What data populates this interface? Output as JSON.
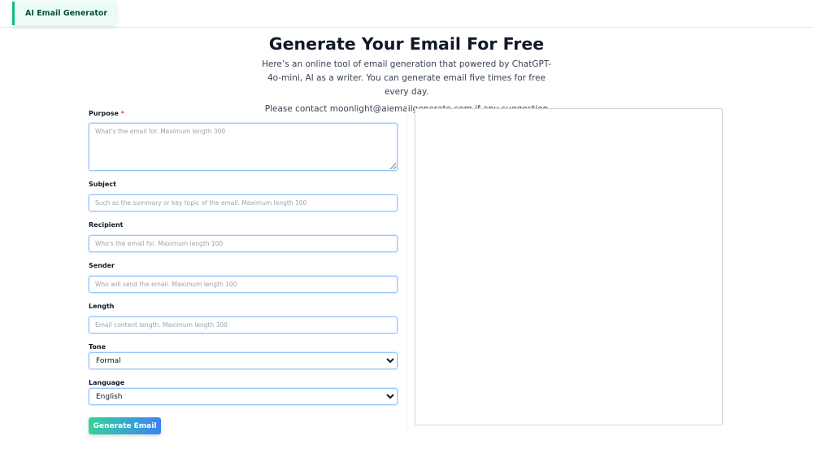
{
  "header": {
    "brand": "AI Email Generator"
  },
  "hero": {
    "title": "Generate Your Email For Free",
    "description": "Here’s an online tool of email generation that powered by ChatGPT-4o-mini, AI as a writer. You can generate email five times for free every day.",
    "contact": "Please contact moonlight@aiemailgenerate.com if any suggestion"
  },
  "form": {
    "purpose": {
      "label": "Purpose",
      "required_mark": "*",
      "placeholder": "What's the email for. Maximum length 300"
    },
    "subject": {
      "label": "Subject",
      "placeholder": "Such as the summary or key topic of the email. Maximum length 100"
    },
    "recipient": {
      "label": "Recipient",
      "placeholder": "Who's the email for. Maximum length 100"
    },
    "sender": {
      "label": "Sender",
      "placeholder": "Who will send the email. Maximum length 100"
    },
    "length": {
      "label": "Length",
      "placeholder": "Email content length. Maximum length 300"
    },
    "tone": {
      "label": "Tone",
      "selected": "Formal"
    },
    "language": {
      "label": "Language",
      "selected": "English"
    },
    "submit_label": "Generate Email"
  },
  "output": {
    "content": ""
  }
}
